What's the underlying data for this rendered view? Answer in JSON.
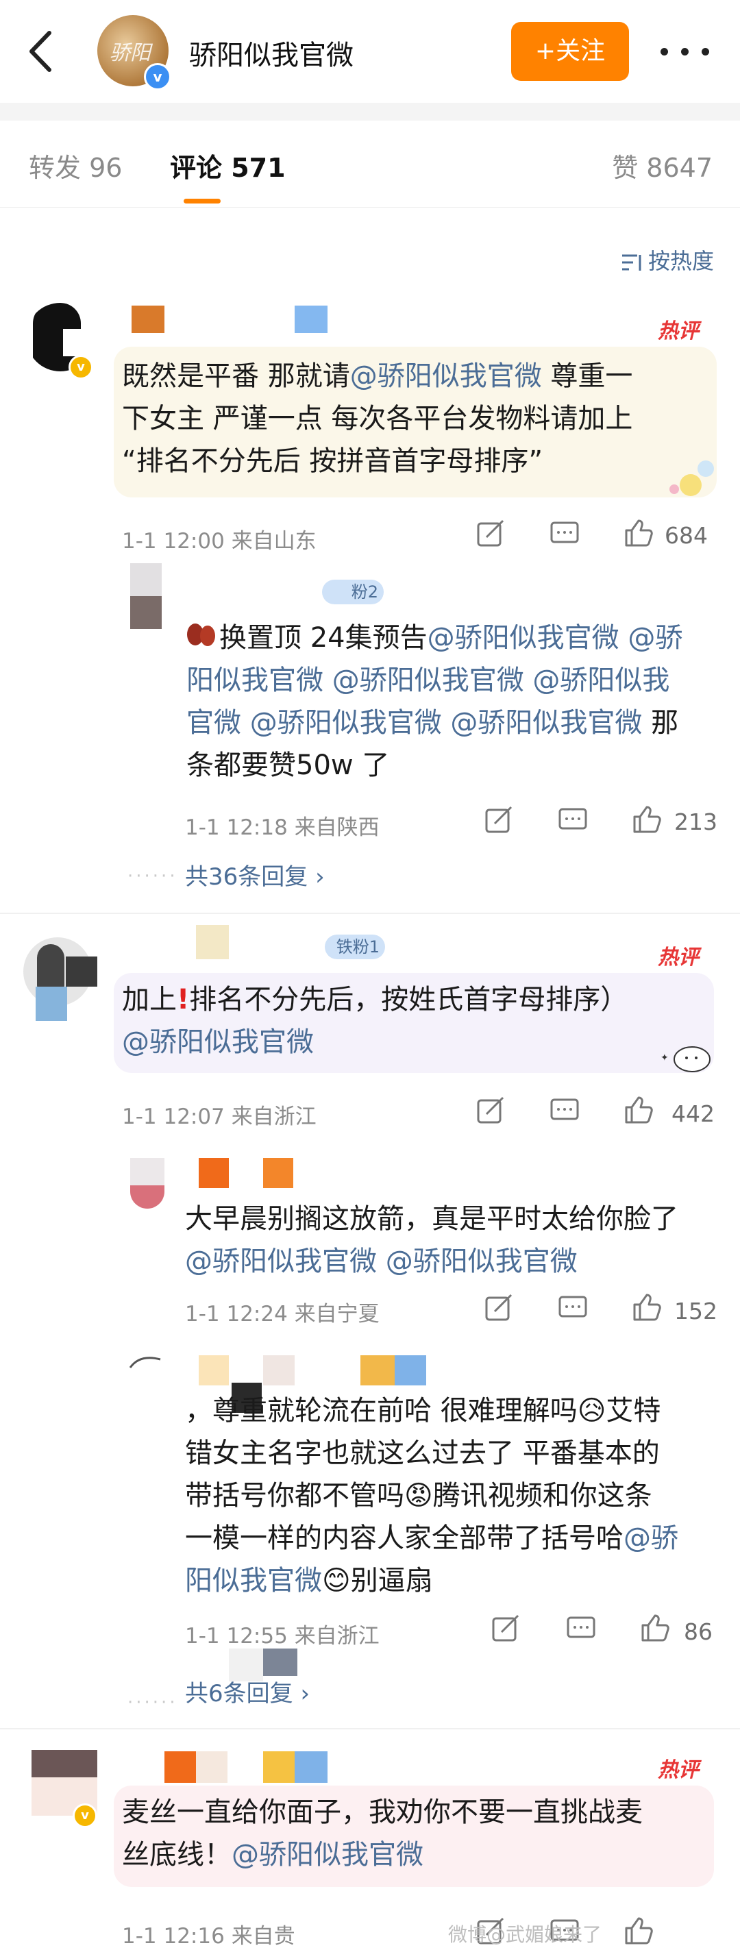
{
  "header": {
    "account_name": "骄阳似我官微",
    "follow_label": "+关注"
  },
  "tabs": {
    "repost": "转发 96",
    "comment": "评论 571",
    "like": "赞 8647"
  },
  "sort": {
    "label": "按热度"
  },
  "hot_label": "热评",
  "comments": [
    {
      "text_a": "既然是平番 那就请",
      "mention_a": "@骄阳似我官微",
      "text_b": "  尊重一",
      "line2": "下女主 严谨一点 每次各平台发物料请加上",
      "line3": "“排名不分先后 按拼音首字母排序”",
      "time": "1-1 12:00",
      "location": "来自山东",
      "likes": "684"
    },
    {
      "reply_line1_a": "换置顶 24集预告",
      "reply_line1_m1": "@骄阳似我官微",
      "reply_line1_m2": " @骄",
      "reply_line2": "阳似我官微 @骄阳似我官微 @骄阳似我",
      "reply_line3_m": "官微 @骄阳似我官微 @骄阳似我官微",
      "reply_line3_t": "  那",
      "reply_line4": "条都要赞50w 了",
      "time": "1-1 12:18",
      "location": "来自陕西",
      "likes": "213",
      "more_replies": "共36条回复 ›",
      "fan_badge": "粉2"
    },
    {
      "line1_a": "加上",
      "line1_b": "排名不分先后，按姓氏首字母排序）",
      "mention": "@骄阳似我官微",
      "time": "1-1 12:07",
      "location": "来自浙江",
      "likes": "442",
      "fan_badge": "铁粉1"
    },
    {
      "line1": "大早晨别搁这放箭，真是平时太给你脸了",
      "mentions": "@骄阳似我官微 @骄阳似我官微",
      "time": "1-1 12:24",
      "location": "来自宁夏",
      "likes": "152"
    },
    {
      "line1_a": "，尊重就轮流在前哈 很难理解吗",
      "line1_b": "艾特",
      "line2": "错女主名字也就这么过去了 平番基本的",
      "line3_a": "带括号你都不管吗",
      "line3_b": "腾讯视频和你这条",
      "line4_a": "一模一样的内容人家全部带了括号哈",
      "line4_m": "@骄",
      "line5_m": "阳似我官微",
      "line5_t": "别逼扇",
      "time": "1-1 12:55",
      "location": "来自浙江",
      "likes": "86",
      "more_replies": "共6条回复 ›"
    },
    {
      "line1": "麦丝一直给你面子，我劝你不要一直挑战麦",
      "line2_t": "丝底线！",
      "line2_m": "@骄阳似我官微",
      "time": "1-1 12:16",
      "location": "来自贵"
    }
  ],
  "watermark": "微博@武媚娘来了",
  "colors": {
    "accent": "#ff8200",
    "link": "#4b6d96",
    "hot": "#e73636"
  }
}
